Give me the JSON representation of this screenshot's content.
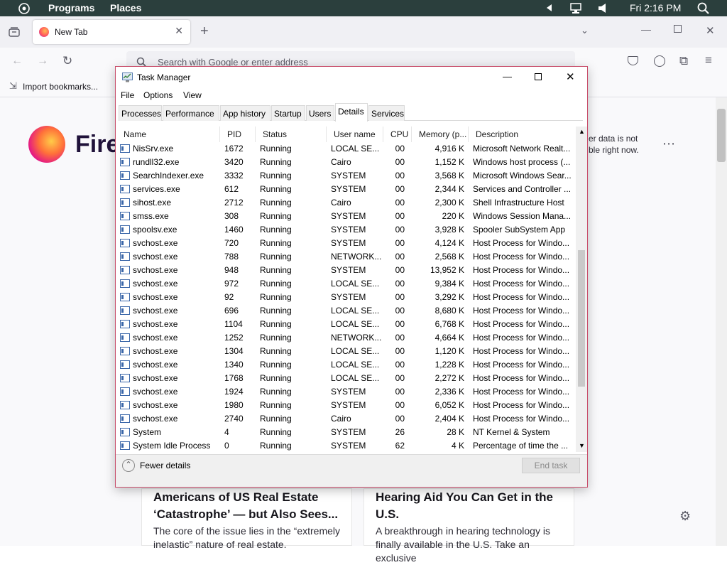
{
  "topbar": {
    "programs": "Programs",
    "places": "Places",
    "clock": "Fri 2:16 PM"
  },
  "browser": {
    "tab_title": "New Tab",
    "url_placeholder": "Search with Google or enter address",
    "bookmarks_import": "Import bookmarks...",
    "logo_text": "Fire",
    "notice": [
      "er data is not",
      "ble right now."
    ]
  },
  "task_manager": {
    "title": "Task Manager",
    "menu": [
      "File",
      "Options",
      "View"
    ],
    "tabs": [
      "Processes",
      "Performance",
      "App history",
      "Startup",
      "Users",
      "Details",
      "Services"
    ],
    "active_tab": "Details",
    "columns": [
      "Name",
      "PID",
      "Status",
      "User name",
      "CPU",
      "Memory (p...",
      "Description"
    ],
    "rows": [
      {
        "name": "NisSrv.exe",
        "pid": "1672",
        "status": "Running",
        "user": "LOCAL SE...",
        "cpu": "00",
        "mem": "4,916 K",
        "desc": "Microsoft Network Realt..."
      },
      {
        "name": "rundll32.exe",
        "pid": "3420",
        "status": "Running",
        "user": "Cairo",
        "cpu": "00",
        "mem": "1,152 K",
        "desc": "Windows host process (..."
      },
      {
        "name": "SearchIndexer.exe",
        "pid": "3332",
        "status": "Running",
        "user": "SYSTEM",
        "cpu": "00",
        "mem": "3,568 K",
        "desc": "Microsoft Windows Sear..."
      },
      {
        "name": "services.exe",
        "pid": "612",
        "status": "Running",
        "user": "SYSTEM",
        "cpu": "00",
        "mem": "2,344 K",
        "desc": "Services and Controller ..."
      },
      {
        "name": "sihost.exe",
        "pid": "2712",
        "status": "Running",
        "user": "Cairo",
        "cpu": "00",
        "mem": "2,300 K",
        "desc": "Shell Infrastructure Host"
      },
      {
        "name": "smss.exe",
        "pid": "308",
        "status": "Running",
        "user": "SYSTEM",
        "cpu": "00",
        "mem": "220 K",
        "desc": "Windows Session Mana..."
      },
      {
        "name": "spoolsv.exe",
        "pid": "1460",
        "status": "Running",
        "user": "SYSTEM",
        "cpu": "00",
        "mem": "3,928 K",
        "desc": "Spooler SubSystem App"
      },
      {
        "name": "svchost.exe",
        "pid": "720",
        "status": "Running",
        "user": "SYSTEM",
        "cpu": "00",
        "mem": "4,124 K",
        "desc": "Host Process for Windo..."
      },
      {
        "name": "svchost.exe",
        "pid": "788",
        "status": "Running",
        "user": "NETWORK...",
        "cpu": "00",
        "mem": "2,568 K",
        "desc": "Host Process for Windo..."
      },
      {
        "name": "svchost.exe",
        "pid": "948",
        "status": "Running",
        "user": "SYSTEM",
        "cpu": "00",
        "mem": "13,952 K",
        "desc": "Host Process for Windo..."
      },
      {
        "name": "svchost.exe",
        "pid": "972",
        "status": "Running",
        "user": "LOCAL SE...",
        "cpu": "00",
        "mem": "9,384 K",
        "desc": "Host Process for Windo..."
      },
      {
        "name": "svchost.exe",
        "pid": "92",
        "status": "Running",
        "user": "SYSTEM",
        "cpu": "00",
        "mem": "3,292 K",
        "desc": "Host Process for Windo..."
      },
      {
        "name": "svchost.exe",
        "pid": "696",
        "status": "Running",
        "user": "LOCAL SE...",
        "cpu": "00",
        "mem": "8,680 K",
        "desc": "Host Process for Windo..."
      },
      {
        "name": "svchost.exe",
        "pid": "1104",
        "status": "Running",
        "user": "LOCAL SE...",
        "cpu": "00",
        "mem": "6,768 K",
        "desc": "Host Process for Windo..."
      },
      {
        "name": "svchost.exe",
        "pid": "1252",
        "status": "Running",
        "user": "NETWORK...",
        "cpu": "00",
        "mem": "4,664 K",
        "desc": "Host Process for Windo..."
      },
      {
        "name": "svchost.exe",
        "pid": "1304",
        "status": "Running",
        "user": "LOCAL SE...",
        "cpu": "00",
        "mem": "1,120 K",
        "desc": "Host Process for Windo..."
      },
      {
        "name": "svchost.exe",
        "pid": "1340",
        "status": "Running",
        "user": "LOCAL SE...",
        "cpu": "00",
        "mem": "1,228 K",
        "desc": "Host Process for Windo..."
      },
      {
        "name": "svchost.exe",
        "pid": "1768",
        "status": "Running",
        "user": "LOCAL SE...",
        "cpu": "00",
        "mem": "2,272 K",
        "desc": "Host Process for Windo..."
      },
      {
        "name": "svchost.exe",
        "pid": "1924",
        "status": "Running",
        "user": "SYSTEM",
        "cpu": "00",
        "mem": "2,336 K",
        "desc": "Host Process for Windo..."
      },
      {
        "name": "svchost.exe",
        "pid": "1980",
        "status": "Running",
        "user": "SYSTEM",
        "cpu": "00",
        "mem": "6,052 K",
        "desc": "Host Process for Windo..."
      },
      {
        "name": "svchost.exe",
        "pid": "2740",
        "status": "Running",
        "user": "Cairo",
        "cpu": "00",
        "mem": "2,404 K",
        "desc": "Host Process for Windo..."
      },
      {
        "name": "System",
        "pid": "4",
        "status": "Running",
        "user": "SYSTEM",
        "cpu": "26",
        "mem": "28 K",
        "desc": "NT Kernel & System"
      },
      {
        "name": "System Idle Process",
        "pid": "0",
        "status": "Running",
        "user": "SYSTEM",
        "cpu": "62",
        "mem": "4 K",
        "desc": "Percentage of time the ..."
      }
    ],
    "fewer_details": "Fewer details",
    "end_task": "End task"
  },
  "cards": [
    {
      "headline": "Americans of US Real Estate ‘Catastrophe’ — but Also Sees...",
      "desc": "The core of the issue lies in the “extremely inelastic” nature of real estate."
    },
    {
      "headline": "Hearing Aid You Can Get in the U.S.",
      "desc": "A breakthrough in hearing technology is finally available in the U.S. Take an exclusive"
    }
  ],
  "colors": {
    "topbar": "#2b3f3d",
    "accent_border": "#c84d6a"
  }
}
